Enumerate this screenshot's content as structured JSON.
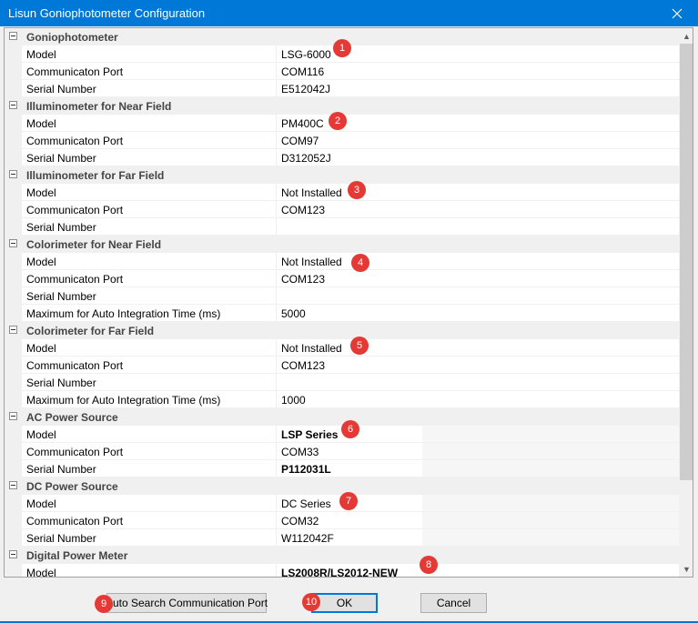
{
  "window": {
    "title": "Lisun Goniophotometer  Configuration",
    "close_icon": "close-icon"
  },
  "categories": [
    {
      "label": "Goniophotometer",
      "rows": [
        {
          "name": "Model",
          "value": "LSG-6000"
        },
        {
          "name": "Communicaton Port",
          "value": "COM116"
        },
        {
          "name": "Serial Number",
          "value": "E512042J"
        }
      ]
    },
    {
      "label": "Illuminometer for Near Field",
      "rows": [
        {
          "name": "Model",
          "value": "PM400C"
        },
        {
          "name": "Communicaton Port",
          "value": "COM97"
        },
        {
          "name": "Serial Number",
          "value": "D312052J"
        }
      ]
    },
    {
      "label": "Illuminometer for Far Field",
      "rows": [
        {
          "name": "Model",
          "value": "Not Installed"
        },
        {
          "name": "Communicaton Port",
          "value": "COM123"
        },
        {
          "name": "Serial Number",
          "value": ""
        }
      ]
    },
    {
      "label": "Colorimeter for Near Field",
      "rows": [
        {
          "name": "Model",
          "value": "Not Installed"
        },
        {
          "name": "Communicaton Port",
          "value": "COM123"
        },
        {
          "name": "Serial Number",
          "value": ""
        },
        {
          "name": "Maximum for Auto Integration Time (ms)",
          "value": "5000"
        }
      ]
    },
    {
      "label": "Colorimeter for Far Field",
      "rows": [
        {
          "name": "Model",
          "value": "Not Installed"
        },
        {
          "name": "Communicaton Port",
          "value": "COM123"
        },
        {
          "name": "Serial Number",
          "value": ""
        },
        {
          "name": "Maximum for Auto Integration Time (ms)",
          "value": "1000"
        }
      ]
    },
    {
      "label": "AC Power Source",
      "rows": [
        {
          "name": "Model",
          "value": "LSP Series"
        },
        {
          "name": "Communicaton Port",
          "value": "COM33"
        },
        {
          "name": "Serial Number",
          "value": "P112031L"
        }
      ]
    },
    {
      "label": "DC Power Source",
      "rows": [
        {
          "name": "Model",
          "value": "DC Series"
        },
        {
          "name": "Communicaton Port",
          "value": "COM32"
        },
        {
          "name": "Serial Number",
          "value": "W112042F"
        }
      ]
    },
    {
      "label": "Digital Power Meter",
      "rows": [
        {
          "name": "Model",
          "value": "LS2008R/LS2012-NEW"
        }
      ]
    }
  ],
  "markers": [
    "1",
    "2",
    "3",
    "4",
    "5",
    "6",
    "7",
    "8",
    "9",
    "10"
  ],
  "buttons": {
    "auto_search": "Auto Search Communication Port",
    "ok": "OK",
    "cancel": "Cancel"
  },
  "colors": {
    "titlebar": "#0078d7",
    "marker": "#e53935",
    "category_bg": "#f0f0f0"
  }
}
